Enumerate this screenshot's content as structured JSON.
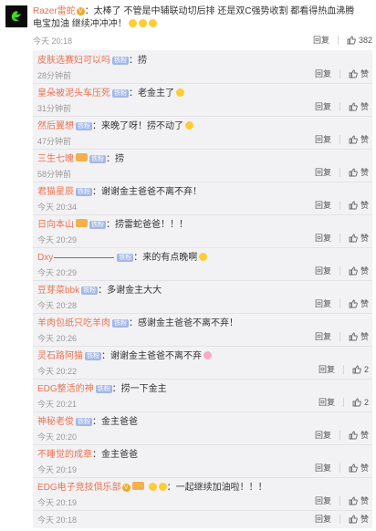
{
  "main": {
    "user": "Razer雷蛇",
    "text": "：太棒了 不管是中辅联动切后排 还是双C强势收割 都看得热血沸腾",
    "text2": "电宝加油 继续冲冲冲！",
    "time": "今天 20:18",
    "reply_label": "回复",
    "likes": "382"
  },
  "reply_label": "回复",
  "like_label": "赞",
  "fan_badge": "铁粉",
  "replies": [
    {
      "user": "皮肤选赛妇可以吗",
      "text": "：捞",
      "time": "28分钟前",
      "likes": "赞"
    },
    {
      "user": "皇朵被泥头车压死",
      "text": "：老金主了",
      "time": "31分钟前",
      "likes": "赞"
    },
    {
      "user": "然后翼想",
      "text": "：来晚了呀！捞不动了",
      "time": "47分钟前",
      "likes": "赞"
    },
    {
      "user": "三生七魄",
      "text": "：捞",
      "time": "58分钟前",
      "likes": "赞"
    },
    {
      "user": "君猫星辰",
      "text": "：谢谢金主爸爸不离不弃！",
      "time": "今天 20:34",
      "likes": "赞"
    },
    {
      "user": "日向本山",
      "text": "：捞雷蛇爸爸！！！",
      "time": "今天 20:29",
      "likes": "赞"
    },
    {
      "user": "Dxy",
      "text": "：来的有点晚啊",
      "time": "今天 20:29",
      "likes": "赞"
    },
    {
      "user": "豆芽菜bbk",
      "text": "：多谢金主大大",
      "time": "今天 20:28",
      "likes": "赞"
    },
    {
      "user": "羊肉包纸只吃羊肉",
      "text": "：感谢金主爸爸不离不弃！",
      "time": "今天 20:26",
      "likes": "赞"
    },
    {
      "user": "灵石路阿猫",
      "text": "：谢谢金主爸爸不离不弃",
      "time": "今天 20:22",
      "likes": "2"
    },
    {
      "user": "EDG整活的神",
      "text": "：捞一下金主",
      "time": "今天 20:21",
      "likes": "2"
    },
    {
      "user": "神秘老俊",
      "text": "：金主爸爸",
      "time": "今天 20:20",
      "likes": "赞"
    },
    {
      "user": "不睡觉的成章",
      "text": "：金主爸爸",
      "time": "今天 20:19",
      "likes": "赞"
    },
    {
      "user": "EDG电子竞技俱乐部",
      "text": "：一起继续加油啦！！！",
      "time": "今天 20:19",
      "likes": "赞"
    },
    {
      "time": "今天 20:18",
      "likes": "赞"
    }
  ]
}
